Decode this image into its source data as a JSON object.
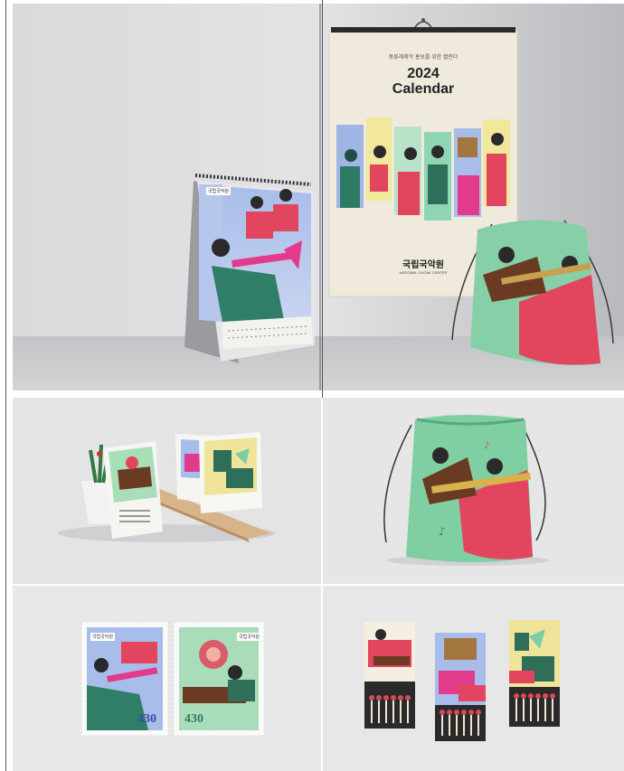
{
  "wall_calendar": {
    "subtitle": "풍류제례악 홍보를 위한 캘린더",
    "year": "2024",
    "title": "Calendar",
    "logo_kr": "국립국악원",
    "logo_en": "NATIONAL GUGAK CENTER"
  },
  "desk_calendar": {
    "badge": "국립국악원"
  },
  "stamps": [
    {
      "value": "430",
      "badge": "국립국악원"
    },
    {
      "value": "430",
      "badge": "국립국악원"
    }
  ],
  "colors": {
    "teal": "#2f7f68",
    "mint": "#7ccfa5",
    "pink": "#e2455e",
    "magenta": "#e23b8c",
    "lavender": "#a9b8e6",
    "cream": "#f1ecd9",
    "yellow": "#efe49a",
    "brown": "#6a3b22"
  }
}
